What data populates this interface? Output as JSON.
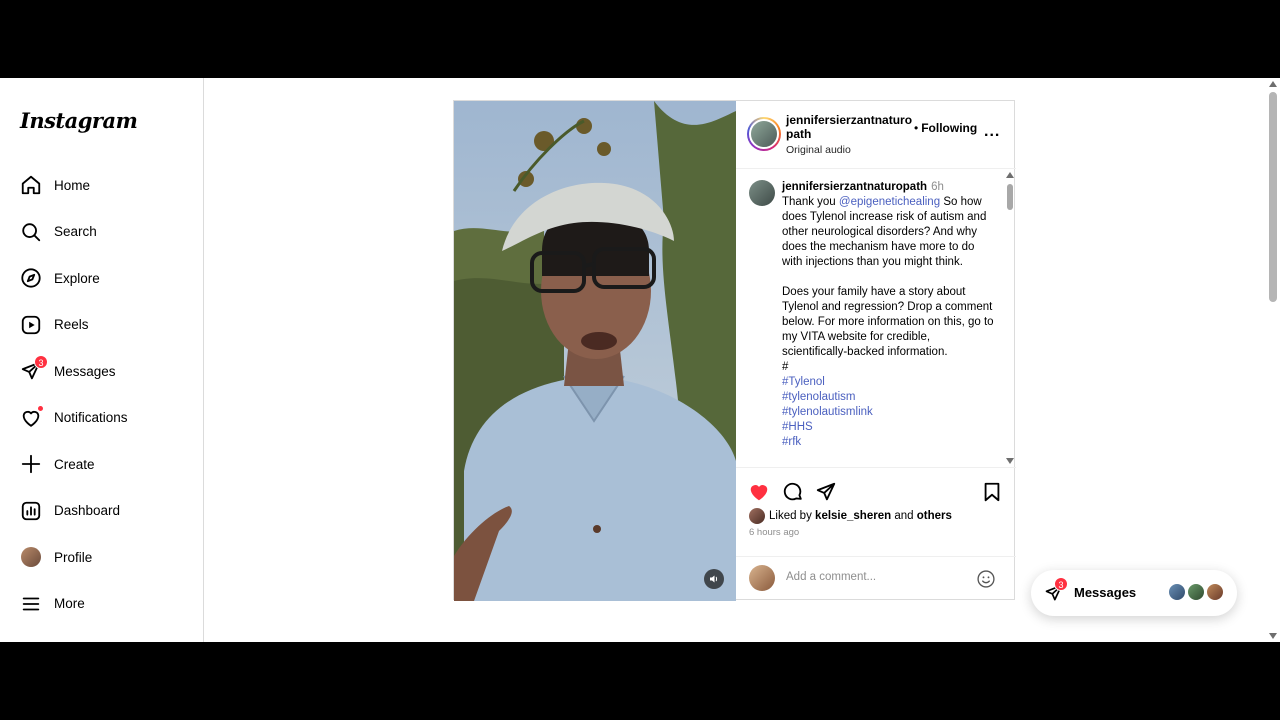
{
  "app": {
    "logo": "Instagram"
  },
  "sidebar": {
    "items": [
      {
        "label": "Home",
        "icon": "home-icon"
      },
      {
        "label": "Search",
        "icon": "search-icon"
      },
      {
        "label": "Explore",
        "icon": "compass-icon"
      },
      {
        "label": "Reels",
        "icon": "reels-icon"
      },
      {
        "label": "Messages",
        "icon": "messenger-icon",
        "badge": "3"
      },
      {
        "label": "Notifications",
        "icon": "heart-icon"
      },
      {
        "label": "Create",
        "icon": "plus-icon"
      },
      {
        "label": "Dashboard",
        "icon": "dashboard-icon"
      },
      {
        "label": "Profile",
        "icon": "avatar"
      },
      {
        "label": "More",
        "icon": "menu-icon"
      }
    ]
  },
  "post": {
    "author": "jennifersierzantnaturopath",
    "follow_sep": "•",
    "follow_state": "Following",
    "audio": "Original audio",
    "more": "...",
    "caption": {
      "user": "jennifersierzantnaturopath",
      "time": "6h",
      "lead": "Thank you",
      "mention": "@epigenetichealing",
      "text1": "So how does Tylenol increase risk of autism and other neurological disorders? And why does the mechanism have more to do with injections than you might think.",
      "text2": "Does your family have a story about Tylenol and regression? Drop a comment below. For more information on this, go to my VITA website for credible, scientifically-backed information.",
      "hash": "#",
      "tags": [
        "#Tylenol",
        "#tylenolautism",
        "#tylenolautismlink",
        "#HHS",
        "#rfk"
      ]
    },
    "liked_prefix": "Liked by",
    "liked_user": "kelsie_sheren",
    "liked_and": "and",
    "liked_others": "others",
    "time_ago": "6 hours ago",
    "comment_placeholder": "Add a comment..."
  },
  "messages_pill": {
    "label": "Messages",
    "badge": "3"
  },
  "colors": {
    "like": "#ff3040",
    "link": "#4a5fbf",
    "badge": "#ff3040"
  }
}
